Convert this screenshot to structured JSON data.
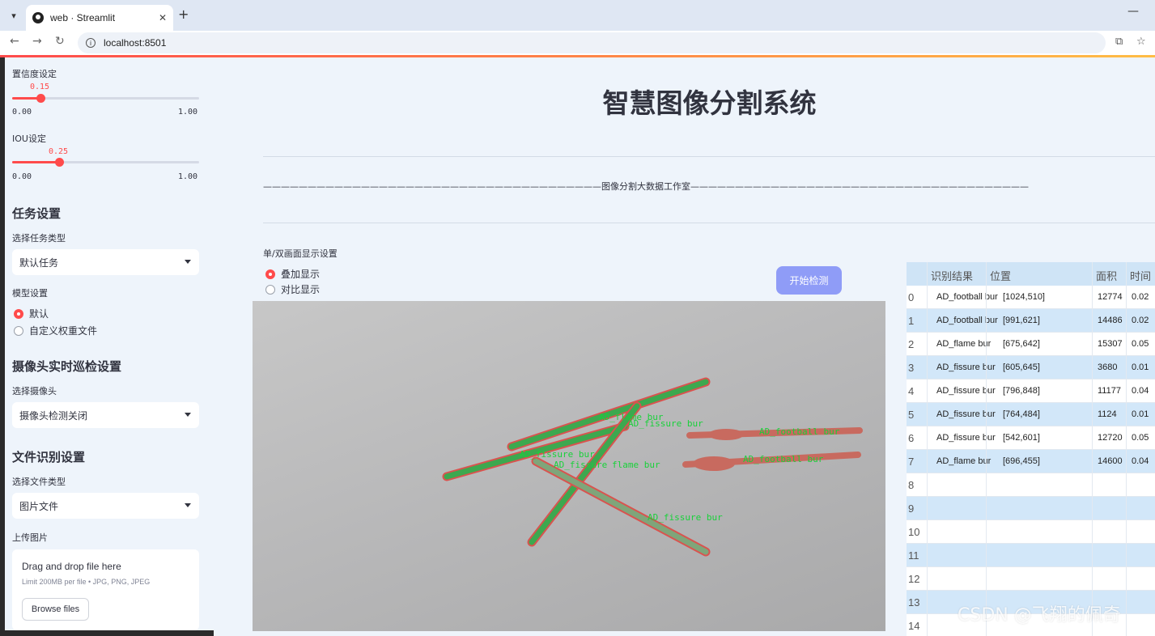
{
  "browser": {
    "tab_title": "web · Streamlit",
    "url": "localhost:8501"
  },
  "sidebar": {
    "conf_label": "置信度设定",
    "conf_value": "0.15",
    "conf_fraction": 0.15,
    "conf_min": "0.00",
    "conf_max": "1.00",
    "iou_label": "IOU设定",
    "iou_value": "0.25",
    "iou_fraction": 0.25,
    "iou_min": "0.00",
    "iou_max": "1.00",
    "task_heading": "任务设置",
    "task_type_label": "选择任务类型",
    "task_type_value": "默认任务",
    "model_label": "模型设置",
    "model_opt_default": "默认",
    "model_opt_custom": "自定义权重文件",
    "camera_heading": "摄像头实时巡检设置",
    "camera_label": "选择摄像头",
    "camera_value": "摄像头检测关闭",
    "file_heading": "文件识别设置",
    "file_type_label": "选择文件类型",
    "file_type_value": "图片文件",
    "upload_label": "上传图片",
    "dropzone_title": "Drag and drop file here",
    "dropzone_sub": "Limit 200MB per file • JPG, PNG, JPEG",
    "browse_label": "Browse files"
  },
  "main": {
    "title": "智慧图像分割系统",
    "banner": "——————————————————————————————————————图像分割大数据工作室——————————————————————————————————————",
    "display_mode_label": "单/双画面显示设置",
    "mode_overlay": "叠加显示",
    "mode_compare": "对比显示",
    "detect_button": "开始检测"
  },
  "image_labels": {
    "l1": "AD_flame bur",
    "l2": "AD_fissure bur",
    "l3": "AD_football bur",
    "l4": "AD_fissure bur",
    "l5": "AD_fissure",
    "l6": "flame bur",
    "l7": "AD_football bur",
    "l8": "AD_fissure bur"
  },
  "table": {
    "headers": {
      "result": "识别结果",
      "position": "位置",
      "area": "面积",
      "time": "时间"
    },
    "rows": [
      {
        "idx": "0",
        "result": "AD_football bur",
        "position": "[1024,510]",
        "area": "12774",
        "time": "0.02"
      },
      {
        "idx": "1",
        "result": "AD_football bur",
        "position": "[991,621]",
        "area": "14486",
        "time": "0.02"
      },
      {
        "idx": "2",
        "result": "AD_flame bur",
        "position": "[675,642]",
        "area": "15307",
        "time": "0.05"
      },
      {
        "idx": "3",
        "result": "AD_fissure bur",
        "position": "[605,645]",
        "area": "3680",
        "time": "0.01"
      },
      {
        "idx": "4",
        "result": "AD_fissure bur",
        "position": "[796,848]",
        "area": "11177",
        "time": "0.04"
      },
      {
        "idx": "5",
        "result": "AD_fissure bur",
        "position": "[764,484]",
        "area": "1124",
        "time": "0.01"
      },
      {
        "idx": "6",
        "result": "AD_fissure bur",
        "position": "[542,601]",
        "area": "12720",
        "time": "0.05"
      },
      {
        "idx": "7",
        "result": "AD_flame bur",
        "position": "[696,455]",
        "area": "14600",
        "time": "0.04"
      },
      {
        "idx": "8",
        "result": "",
        "position": "",
        "area": "",
        "time": ""
      },
      {
        "idx": "9",
        "result": "",
        "position": "",
        "area": "",
        "time": ""
      },
      {
        "idx": "10",
        "result": "",
        "position": "",
        "area": "",
        "time": ""
      },
      {
        "idx": "11",
        "result": "",
        "position": "",
        "area": "",
        "time": ""
      },
      {
        "idx": "12",
        "result": "",
        "position": "",
        "area": "",
        "time": ""
      },
      {
        "idx": "13",
        "result": "",
        "position": "",
        "area": "",
        "time": ""
      },
      {
        "idx": "14",
        "result": "",
        "position": "",
        "area": "",
        "time": ""
      }
    ]
  },
  "watermark": "CSDN @飞翔的佩奇",
  "colors": {
    "accent": "#ff4b4b",
    "button": "#8f9cf7",
    "row_alt": "#d2e7f9",
    "mask_green": "#2ea84a",
    "mask_red": "#d9534f"
  }
}
